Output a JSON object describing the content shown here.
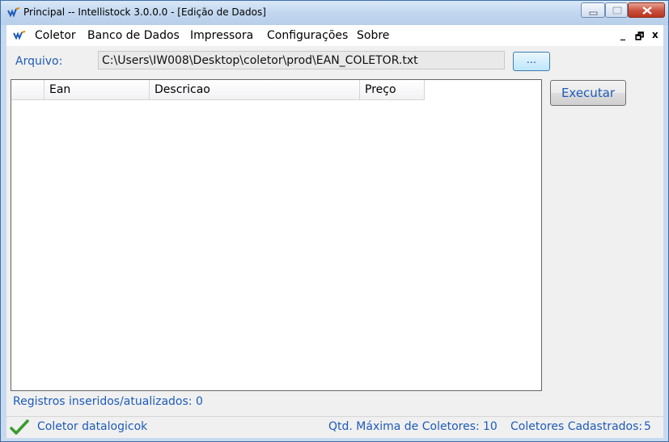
{
  "window": {
    "title": "Principal -- Intellistock 3.0.0.0 - [Edição de Dados]",
    "icon": "app-logo-icon"
  },
  "menu": {
    "items": [
      "Coletor",
      "Banco de Dados",
      "Impressora",
      "Configurações",
      "Sobre"
    ],
    "mdi_minimize": "_",
    "mdi_restore": "🗗",
    "mdi_close": "x"
  },
  "form": {
    "arquivo_label": "Arquivo:",
    "arquivo_value": "C:\\Users\\IW008\\Desktop\\coletor\\prod\\EAN_COLETOR.txt",
    "browse_label": "...",
    "execute_label": "Executar",
    "grid_columns": [
      "",
      "Ean",
      "Descricao",
      "Preço"
    ],
    "registros_text": "Registros inseridos/atualizados: 0"
  },
  "status": {
    "coletor_text": "Coletor datalogicok",
    "max_label": "Qtd. Máxima de Coletores:",
    "max_value": "10",
    "cadastrados_label": "Coletores Cadastrados:",
    "cadastrados_value": "5",
    "accent": "#1e5bb8",
    "check_color": "#3a9a2e"
  }
}
